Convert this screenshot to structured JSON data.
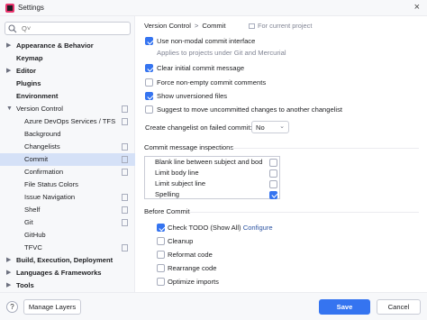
{
  "window": {
    "title": "Settings"
  },
  "search": {
    "placeholder": "Q˅",
    "value": ""
  },
  "sidebar": {
    "items": [
      {
        "label": "Appearance & Behavior",
        "bold": true,
        "arrow": "▶"
      },
      {
        "label": "Keymap",
        "bold": true
      },
      {
        "label": "Editor",
        "bold": true,
        "arrow": "▶"
      },
      {
        "label": "Plugins",
        "bold": true
      },
      {
        "label": "Environment",
        "bold": true
      },
      {
        "label": "Version Control",
        "bold": false,
        "arrow": "▼"
      },
      {
        "label": "Azure DevOps Services / TFS"
      },
      {
        "label": "Background"
      },
      {
        "label": "Changelists"
      },
      {
        "label": "Commit",
        "selected": true
      },
      {
        "label": "Confirmation"
      },
      {
        "label": "File Status Colors"
      },
      {
        "label": "Issue Navigation"
      },
      {
        "label": "Shelf"
      },
      {
        "label": "Git"
      },
      {
        "label": "GitHub"
      },
      {
        "label": "TFVC"
      },
      {
        "label": "Build, Execution, Deployment",
        "bold": true,
        "arrow": "▶"
      },
      {
        "label": "Languages & Frameworks",
        "bold": true,
        "arrow": "▶"
      },
      {
        "label": "Tools",
        "bold": true,
        "arrow": "▶"
      }
    ]
  },
  "breadcrumb": {
    "parent": "Version Control",
    "separator": ">",
    "current": "Commit"
  },
  "scope_note": "For current project",
  "options": {
    "non_modal": {
      "label": "Use non-modal commit interface",
      "checked": true,
      "hint": "Applies to projects under Git and Mercurial"
    },
    "clear_initial": {
      "label": "Clear initial commit message",
      "checked": true
    },
    "force_non_empty": {
      "label": "Force non-empty commit comments",
      "checked": false
    },
    "show_unversioned": {
      "label": "Show unversioned files",
      "checked": true
    },
    "suggest_move": {
      "label": "Suggest to move uncommitted changes to another changelist",
      "checked": false
    }
  },
  "changelist_select": {
    "label": "Create changelist on failed commit:",
    "value": "No",
    "chevron": "⌄"
  },
  "inspections": {
    "title": "Commit message inspections",
    "rows": [
      {
        "label": "Blank line between subject and bod",
        "checked": false
      },
      {
        "label": "Limit body line",
        "checked": false
      },
      {
        "label": "Limit subject line",
        "checked": false
      },
      {
        "label": "Spelling",
        "checked": true
      }
    ]
  },
  "before_commit": {
    "title": "Before Commit",
    "items": [
      {
        "label": "Check TODO (Show All)",
        "link": "Configure",
        "checked": true
      },
      {
        "label": "Cleanup",
        "checked": false
      },
      {
        "label": "Reformat code",
        "checked": false
      },
      {
        "label": "Rearrange code",
        "checked": false
      },
      {
        "label": "Optimize imports",
        "checked": false
      }
    ]
  },
  "footer": {
    "help": "?",
    "manage_layers": "Manage Layers",
    "save": "Save",
    "cancel": "Cancel"
  },
  "colors": {
    "accent": "#3574f0",
    "selection": "#d5e1f7",
    "link": "#2e55a3"
  }
}
